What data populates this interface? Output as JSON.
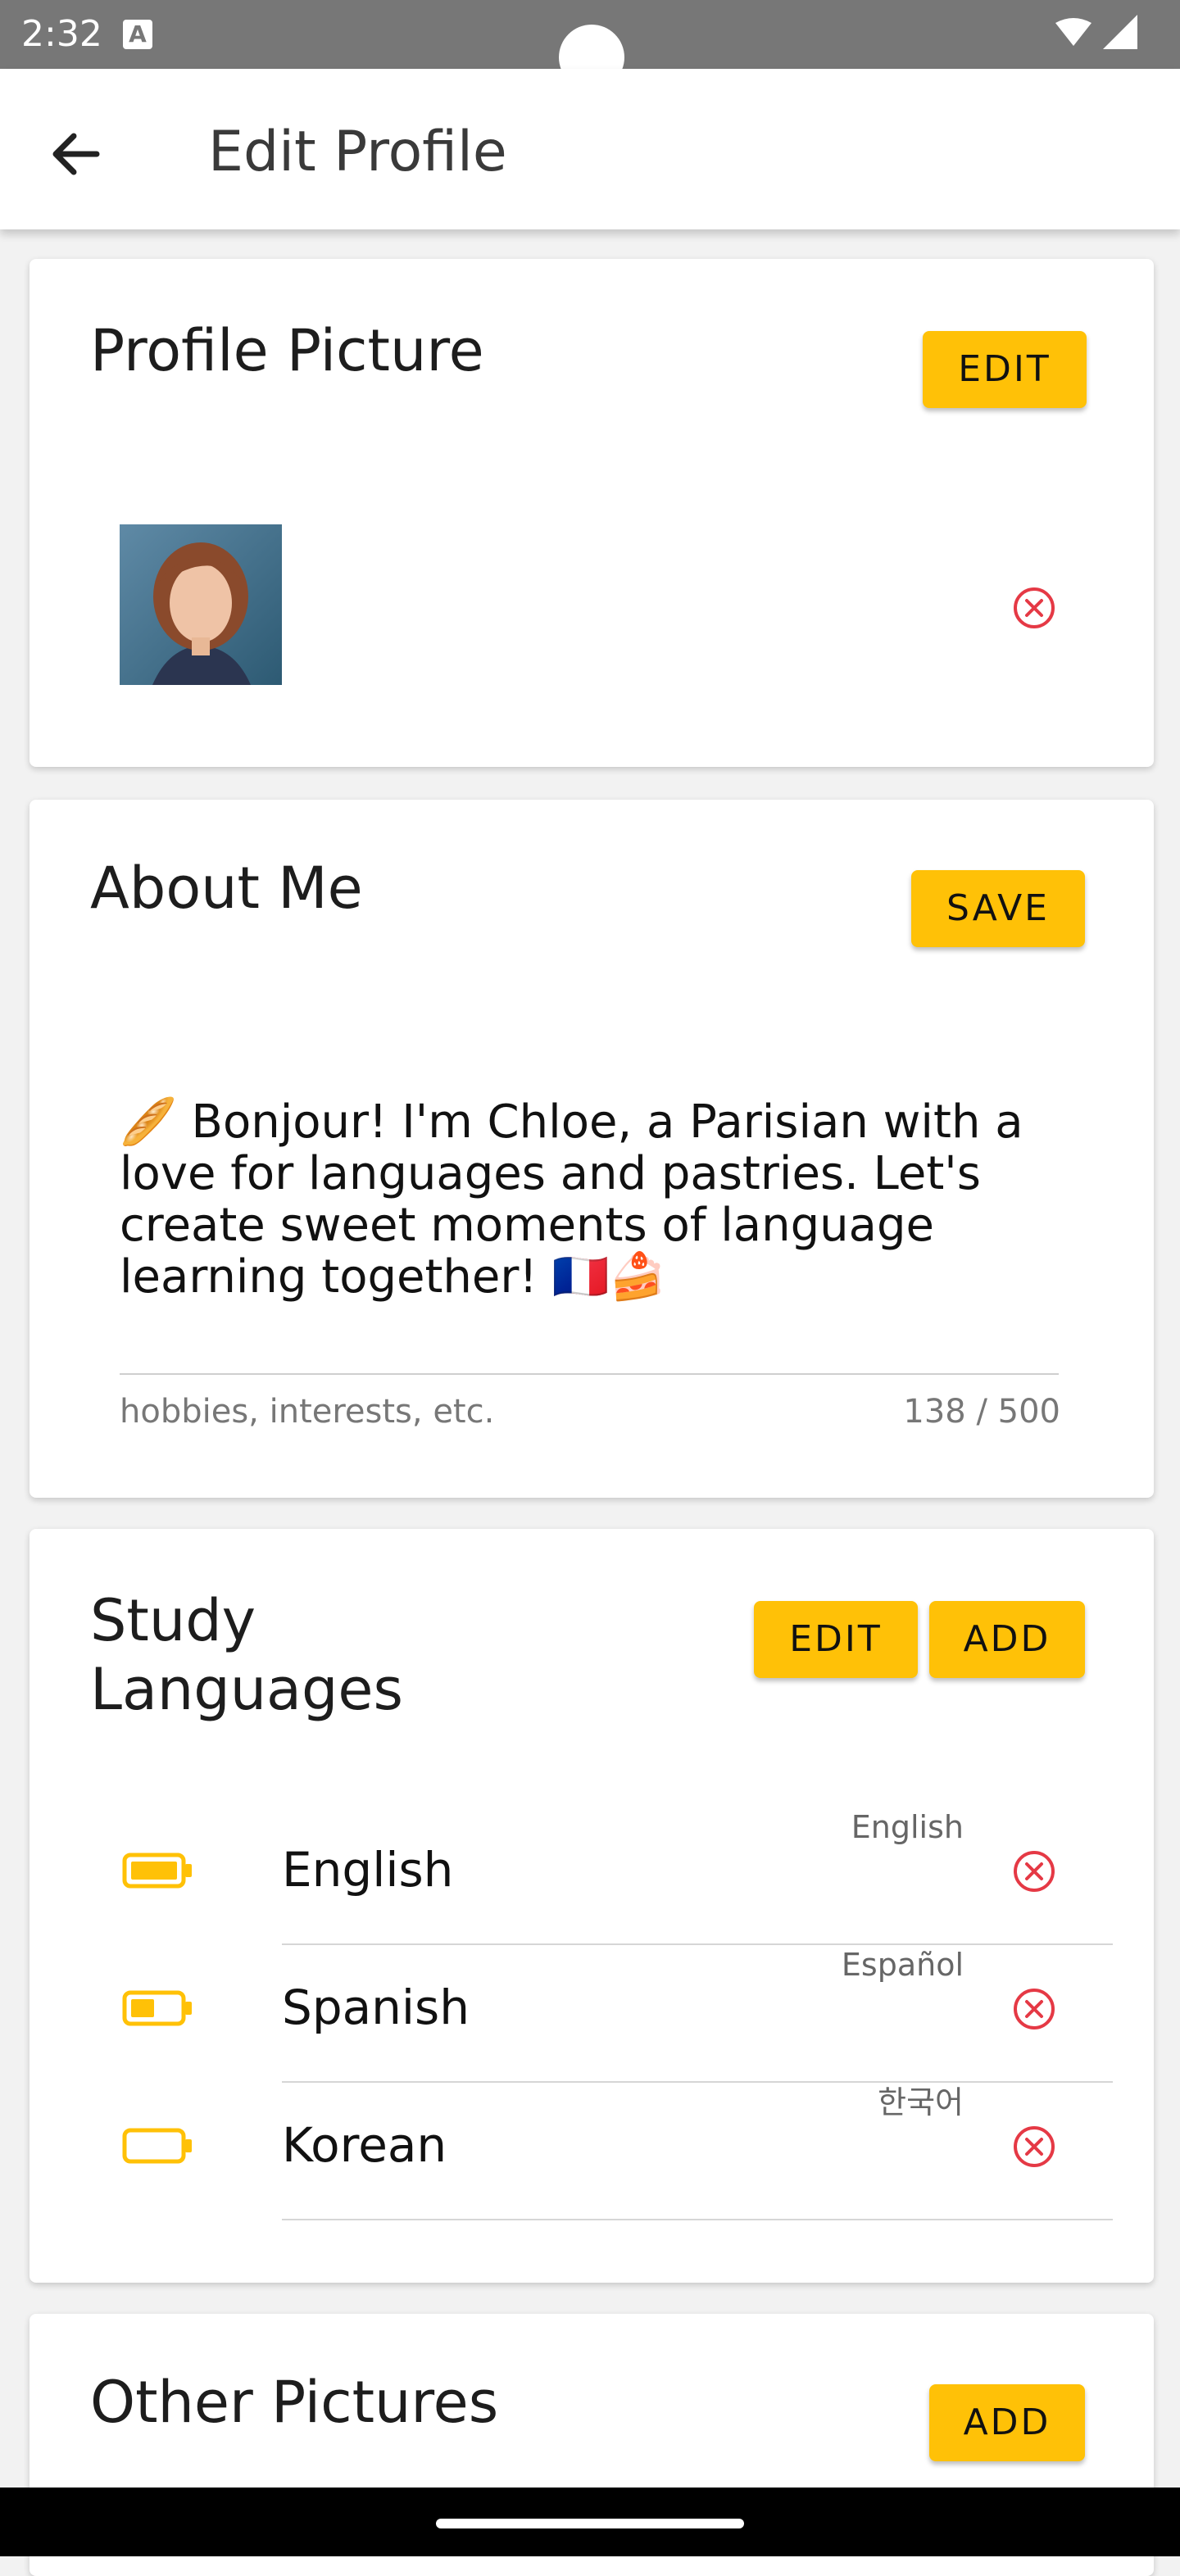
{
  "status_bar": {
    "time": "2:32",
    "badge": "A"
  },
  "app_bar": {
    "title": "Edit Profile",
    "back_icon": "arrow-left-icon"
  },
  "profile_picture": {
    "title": "Profile Picture",
    "edit_label": "EDIT"
  },
  "about_me": {
    "title": "About Me",
    "save_label": "SAVE",
    "text": "🥖 Bonjour! I'm Chloe, a Parisian with a love for languages and pastries. Let's create sweet moments of language learning together! 🇫🇷🍰",
    "hint": "hobbies, interests, etc.",
    "counter": "138 / 500"
  },
  "study_languages": {
    "title_line1": "Study",
    "title_line2": "Languages",
    "edit_label": "EDIT",
    "add_label": "ADD",
    "items": [
      {
        "name": "English",
        "native": "English",
        "level": 0.9
      },
      {
        "name": "Spanish",
        "native": "Español",
        "level": 0.5
      },
      {
        "name": "Korean",
        "native": "한국어",
        "level": 0.0
      }
    ]
  },
  "other_pictures": {
    "title": "Other Pictures",
    "add_label": "ADD"
  },
  "colors": {
    "accent": "#ffc107",
    "remove": "#e53945",
    "status_bar": "#777777"
  }
}
